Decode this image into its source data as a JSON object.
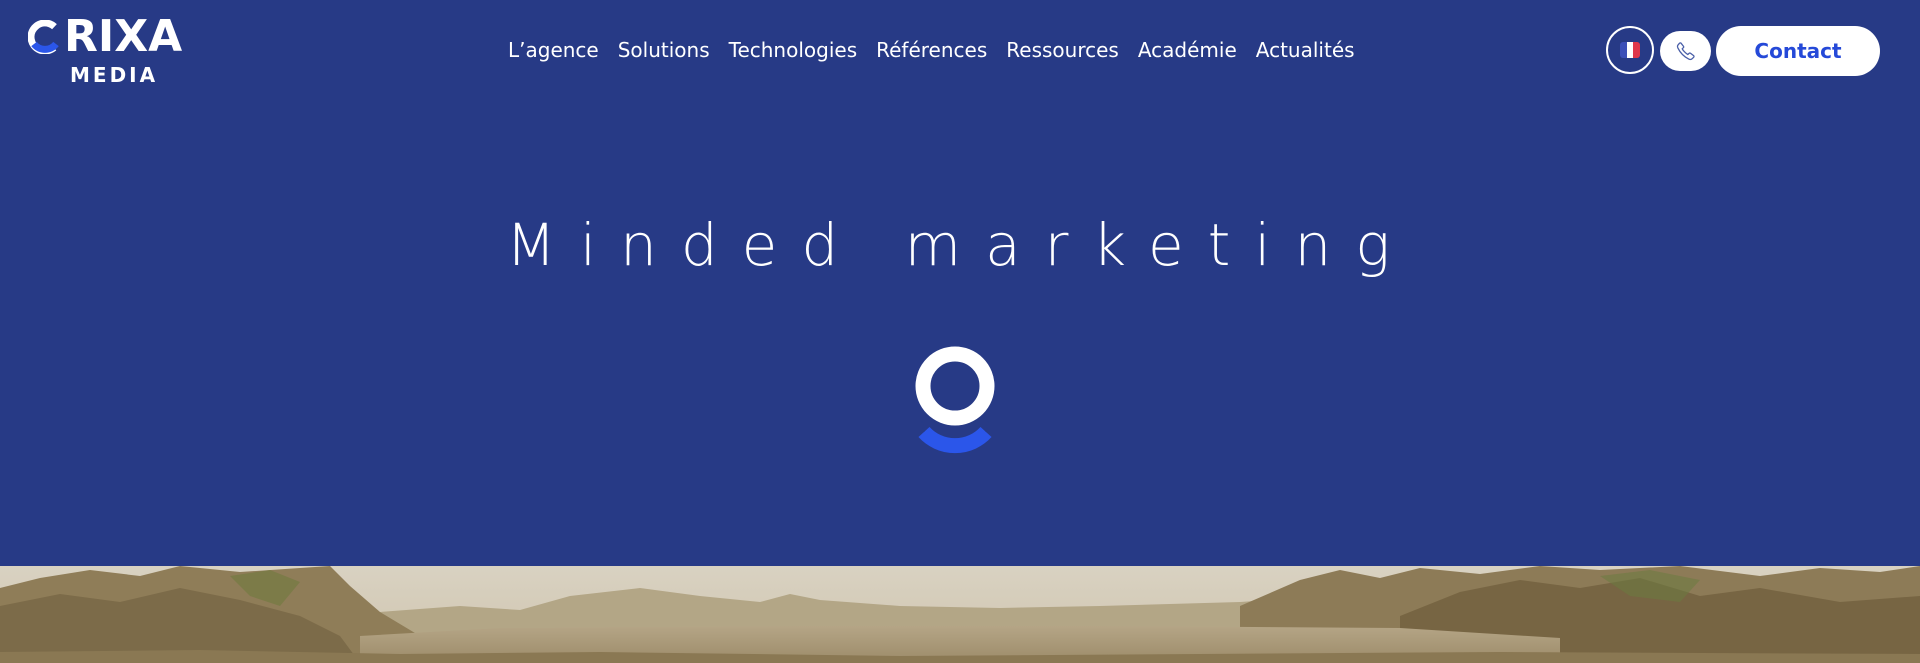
{
  "brand": {
    "logo_text": "RIXA",
    "logo_sub": "MEDIA",
    "logo_full": "ORIXA MEDIA",
    "accent_color": "#2b56ea",
    "background_color": "#273a86"
  },
  "nav": {
    "items": [
      {
        "label": "L’agence"
      },
      {
        "label": "Solutions"
      },
      {
        "label": "Technologies"
      },
      {
        "label": "Références"
      },
      {
        "label": "Ressources"
      },
      {
        "label": "Académie"
      },
      {
        "label": "Actualités"
      }
    ]
  },
  "header_actions": {
    "language_icon": "france-flag-icon",
    "phone_icon": "phone-icon",
    "contact_label": "Contact"
  },
  "hero": {
    "title": "Minded marketing",
    "loader_icon": "orixa-loader-icon"
  }
}
